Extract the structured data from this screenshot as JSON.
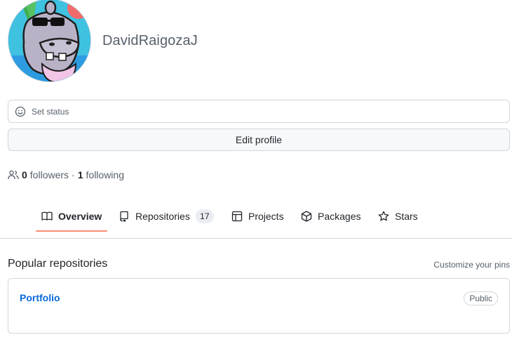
{
  "profile": {
    "username": "DavidRaigozaJ",
    "avatar_alt": "hippo-with-sunglasses-avatar"
  },
  "status": {
    "label": "Set status",
    "icon": "smiley-icon"
  },
  "edit_profile": {
    "label": "Edit profile"
  },
  "follow": {
    "followers_count": "0",
    "followers_label": "followers",
    "separator": "·",
    "following_count": "1",
    "following_label": "following",
    "icon": "people-icon"
  },
  "tabs": [
    {
      "label": "Overview",
      "icon": "book-icon",
      "active": true
    },
    {
      "label": "Repositories",
      "icon": "repo-icon",
      "count": "17"
    },
    {
      "label": "Projects",
      "icon": "table-icon"
    },
    {
      "label": "Packages",
      "icon": "package-icon"
    },
    {
      "label": "Stars",
      "icon": "star-icon"
    }
  ],
  "popular": {
    "title": "Popular repositories",
    "customize_label": "Customize your pins",
    "repos": [
      {
        "name": "Portfolio",
        "visibility": "Public"
      }
    ]
  },
  "colors": {
    "link": "#0969da",
    "active_tab_underline": "#fd8c73",
    "border": "#d0d7de",
    "muted_text": "#57606a"
  }
}
